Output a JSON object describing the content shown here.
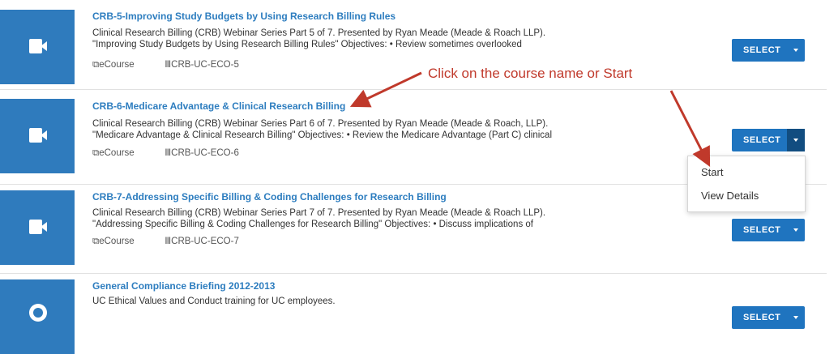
{
  "courses": [
    {
      "title": "CRB-5-Improving Study Budgets by Using Research Billing Rules",
      "desc_line1": "Clinical Research Billing (CRB) Webinar Series Part 5 of 7. Presented by Ryan Meade (Meade & Roach LLP).",
      "desc_line2": "\"Improving Study Budgets by Using Research Billing Rules\" Objectives: • Review sometimes overlooked",
      "type": "eCourse",
      "code": "CRB-UC-ECO-5",
      "select_label": "SELECT"
    },
    {
      "title": "CRB-6-Medicare Advantage & Clinical Research Billing",
      "desc_line1": "Clinical Research Billing (CRB) Webinar Series Part 6 of 7. Presented by Ryan Meade (Meade & Roach, LLP).",
      "desc_line2": "\"Medicare Advantage & Clinical Research Billing\" Objectives: • Review the Medicare Advantage (Part C) clinical",
      "type": "eCourse",
      "code": "CRB-UC-ECO-6",
      "select_label": "SELECT"
    },
    {
      "title": "CRB-7-Addressing Specific Billing & Coding Challenges for Research Billing",
      "desc_line1": "Clinical Research Billing (CRB) Webinar Series Part 7 of 7. Presented by Ryan Meade (Meade & Roach LLP).",
      "desc_line2": "\"Addressing Specific Billing & Coding Challenges for Research Billing\" Objectives: • Discuss implications of",
      "type": "eCourse",
      "code": "CRB-UC-ECO-7",
      "select_label": "SELECT"
    },
    {
      "title": "General Compliance Briefing 2012-2013",
      "desc_line1": "UC Ethical Values and Conduct training for UC employees.",
      "select_label": "SELECT"
    }
  ],
  "dropdown": {
    "start": "Start",
    "view_details": "View Details"
  },
  "annotation": "Click on the course name or Start",
  "colors": {
    "accent": "#1f74bf",
    "thumb": "#2f7bbd",
    "annotation": "#c0392b"
  },
  "icons": {
    "video": "video-camera-icon",
    "globe": "globe-icon",
    "caret": "caret-down-icon"
  }
}
